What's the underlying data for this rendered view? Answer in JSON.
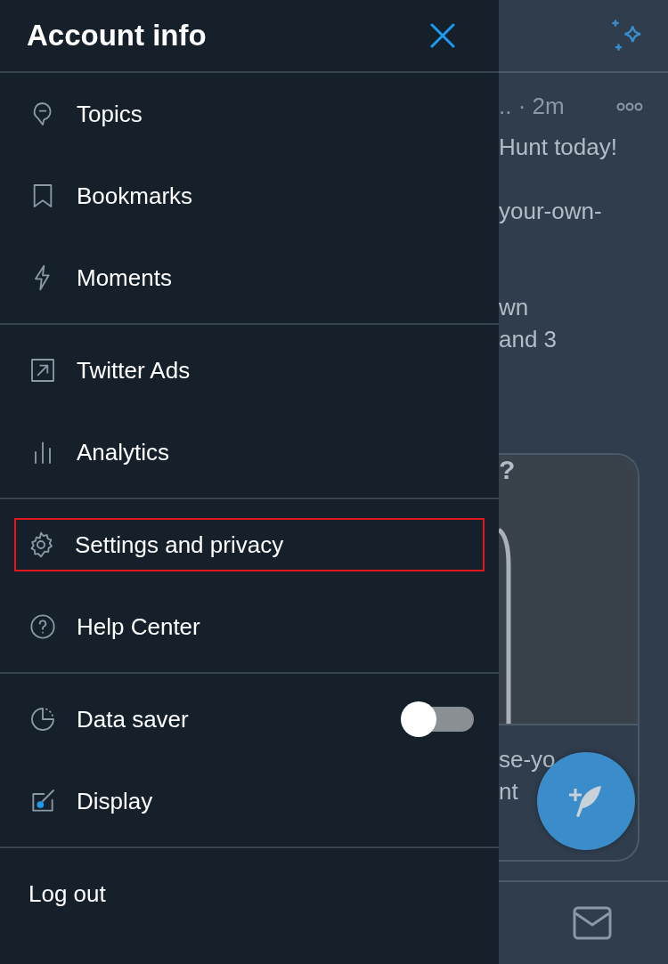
{
  "drawer": {
    "title": "Account info",
    "sections": [
      {
        "items": [
          {
            "kind": "link",
            "label": "Topics",
            "highlighted": false
          },
          {
            "kind": "link",
            "label": "Bookmarks",
            "highlighted": false
          },
          {
            "kind": "link",
            "label": "Moments",
            "highlighted": false
          }
        ]
      },
      {
        "items": [
          {
            "kind": "link",
            "label": "Twitter Ads",
            "highlighted": false
          },
          {
            "kind": "link",
            "label": "Analytics",
            "highlighted": false
          }
        ]
      },
      {
        "items": [
          {
            "kind": "link",
            "label": "Settings and privacy",
            "highlighted": true
          },
          {
            "kind": "link",
            "label": "Help Center",
            "highlighted": false
          }
        ]
      },
      {
        "items": [
          {
            "kind": "toggle",
            "label": "Data saver",
            "on": false
          },
          {
            "kind": "link",
            "label": "Display",
            "highlighted": false
          }
        ]
      },
      {
        "items": [
          {
            "kind": "plain",
            "label": "Log out",
            "highlighted": false
          }
        ]
      }
    ]
  },
  "feed": {
    "meta": "..  · 2m",
    "lines": [
      "Hunt today!",
      "your-own-",
      "wn",
      "and 3"
    ],
    "card": {
      "heading": "?",
      "lines": [
        "se-yo",
        "nt"
      ]
    }
  }
}
